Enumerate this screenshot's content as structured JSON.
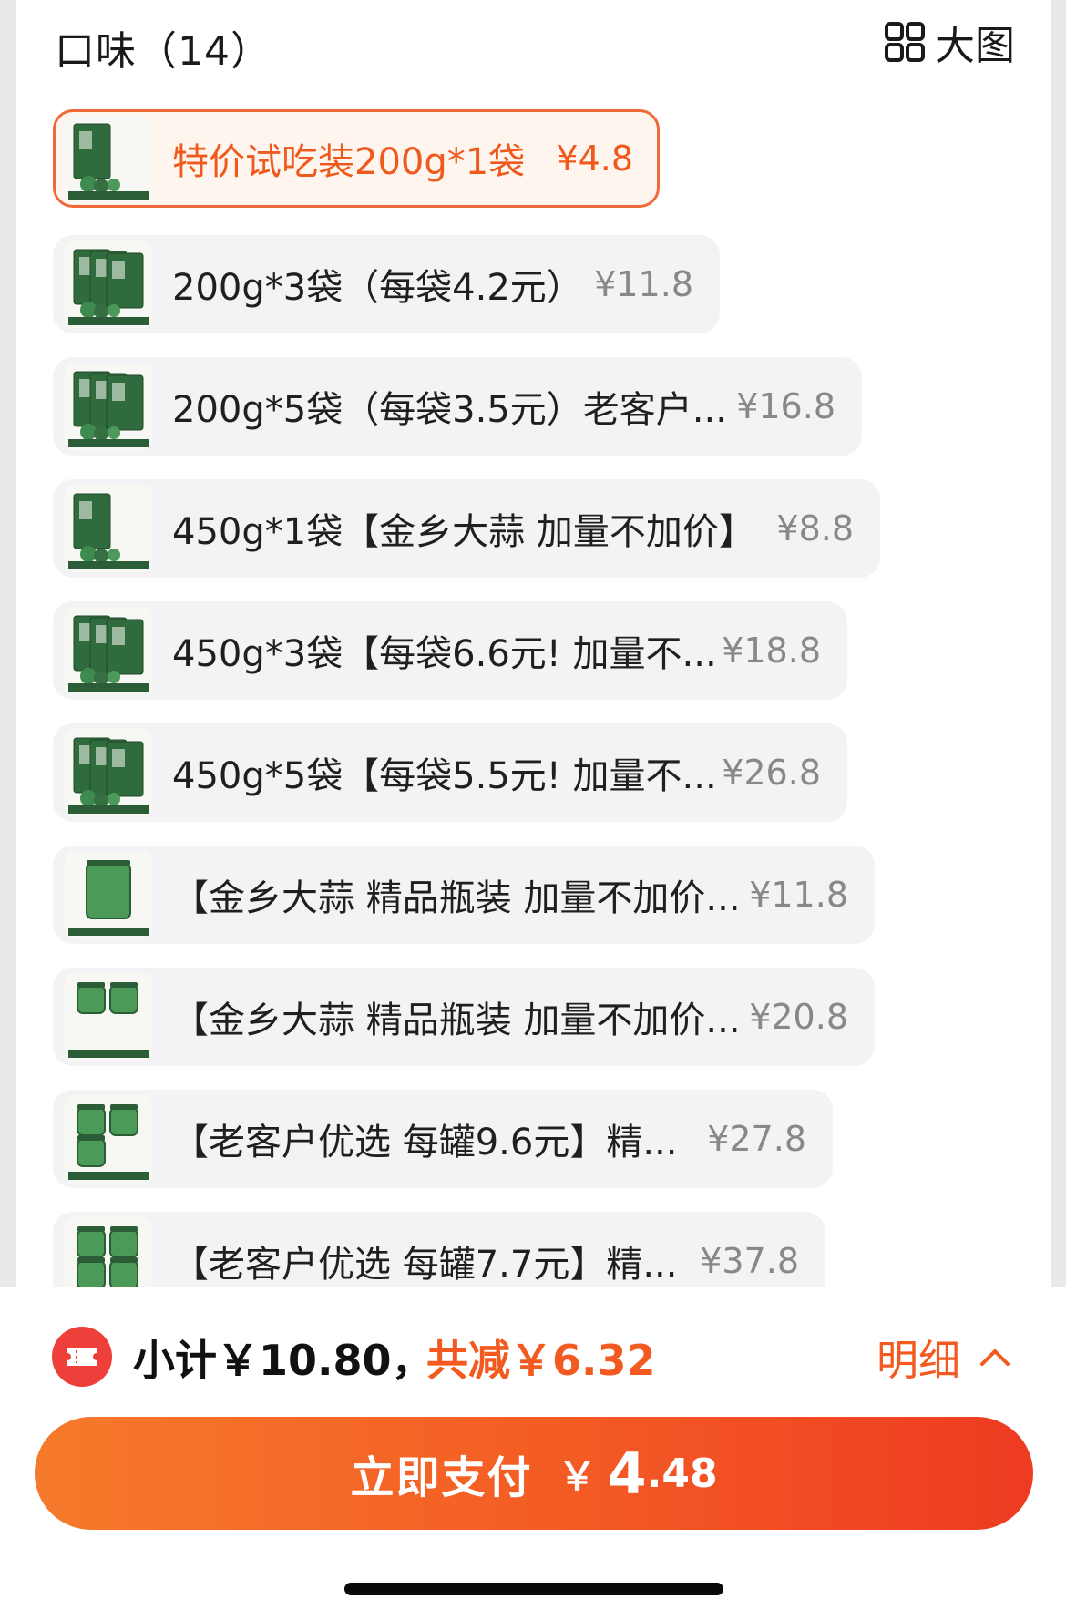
{
  "header": {
    "title": "口味（14）",
    "view_toggle_label": "大图"
  },
  "options": [
    {
      "label": "特价试吃装200g*1袋",
      "price": "¥4.8",
      "selected": true,
      "thumb": "bag-1"
    },
    {
      "label": "200g*3袋（每袋4.2元）",
      "price": "¥11.8",
      "selected": false,
      "thumb": "bag-3"
    },
    {
      "label": "200g*5袋（每袋3.5元）老客户...",
      "price": "¥16.8",
      "selected": false,
      "thumb": "bag-5"
    },
    {
      "label": "450g*1袋【金乡大蒜 加量不加价】",
      "price": "¥8.8",
      "selected": false,
      "thumb": "bag-1"
    },
    {
      "label": "450g*3袋【每袋6.6元! 加量不...",
      "price": "¥18.8",
      "selected": false,
      "thumb": "bag-3"
    },
    {
      "label": "450g*5袋【每袋5.5元! 加量不...",
      "price": "¥26.8",
      "selected": false,
      "thumb": "bag-5"
    },
    {
      "label": "【金乡大蒜 精品瓶装 加量不加价...",
      "price": "¥11.8",
      "selected": false,
      "thumb": "jar-1"
    },
    {
      "label": "【金乡大蒜 精品瓶装 加量不加价...",
      "price": "¥20.8",
      "selected": false,
      "thumb": "jar-2"
    },
    {
      "label": "【老客户优选 每罐9.6元】精...",
      "price": "¥27.8",
      "selected": false,
      "thumb": "jar-3"
    },
    {
      "label": "【老客户优选 每罐7.7元】精...",
      "price": "¥37.8",
      "selected": false,
      "thumb": "jar-4"
    }
  ],
  "footer": {
    "subtotal": "小计￥10.80，",
    "discount": "共减￥6.32",
    "detail_label": "明细",
    "pay_label": "立即支付",
    "pay_symbol": "￥",
    "pay_int": "4",
    "pay_dec": ".48"
  },
  "colors": {
    "accent": "#f25a1f",
    "selected_border": "#ef6a3a",
    "product_green": "#2f6b3c"
  },
  "icons": {
    "view_toggle": "grid-icon",
    "coupon": "coupon-icon",
    "detail": "chevron-up-icon"
  }
}
